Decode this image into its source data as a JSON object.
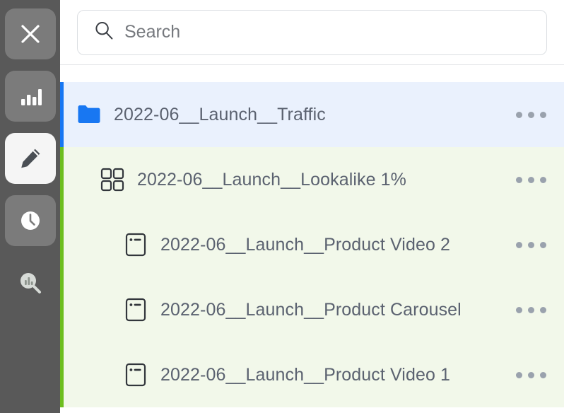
{
  "rail": {
    "items": [
      {
        "name": "close-button",
        "icon": "close-icon",
        "state": "inactive"
      },
      {
        "name": "analytics-button",
        "icon": "bar-chart-icon",
        "state": "inactive"
      },
      {
        "name": "edit-button",
        "icon": "pencil-icon",
        "state": "active"
      },
      {
        "name": "history-button",
        "icon": "clock-icon",
        "state": "inactive"
      },
      {
        "name": "inspect-button",
        "icon": "chart-search-icon",
        "state": "plain"
      }
    ]
  },
  "search": {
    "placeholder": "Search",
    "value": "",
    "icon": "search-icon"
  },
  "tree": {
    "rows": [
      {
        "label": "2022-06__Launch__Traffic",
        "level": 0,
        "type": "campaign",
        "icon": "folder-icon",
        "accent_color": "#1877F2",
        "background_color": "#EAF1FD",
        "menu": "kebab-menu"
      },
      {
        "label": "2022-06__Launch__Lookalike 1%",
        "level": 1,
        "type": "adset",
        "icon": "grid-icon",
        "accent_color": "#6DBE1E",
        "background_color": "#F2F8EA",
        "menu": "kebab-menu"
      },
      {
        "label": "2022-06__Launch__Product Video 2",
        "level": 2,
        "type": "ad",
        "icon": "ad-card-icon",
        "accent_color": "#6DBE1E",
        "background_color": "#F2F8EA",
        "menu": "kebab-menu"
      },
      {
        "label": "2022-06__Launch__Product Carousel",
        "level": 2,
        "type": "ad",
        "icon": "ad-card-icon",
        "accent_color": "#6DBE1E",
        "background_color": "#F2F8EA",
        "menu": "kebab-menu"
      },
      {
        "label": "2022-06__Launch__Product Video 1",
        "level": 2,
        "type": "ad",
        "icon": "ad-card-icon",
        "accent_color": "#6DBE1E",
        "background_color": "#F2F8EA",
        "menu": "kebab-menu"
      }
    ]
  },
  "colors": {
    "rail_background": "#595959",
    "rail_button": "#7B7B7B",
    "rail_button_active": "#F5F5F5",
    "campaign_accent": "#1877F2",
    "adset_accent": "#6DBE1E",
    "row_text": "#5B6270"
  }
}
